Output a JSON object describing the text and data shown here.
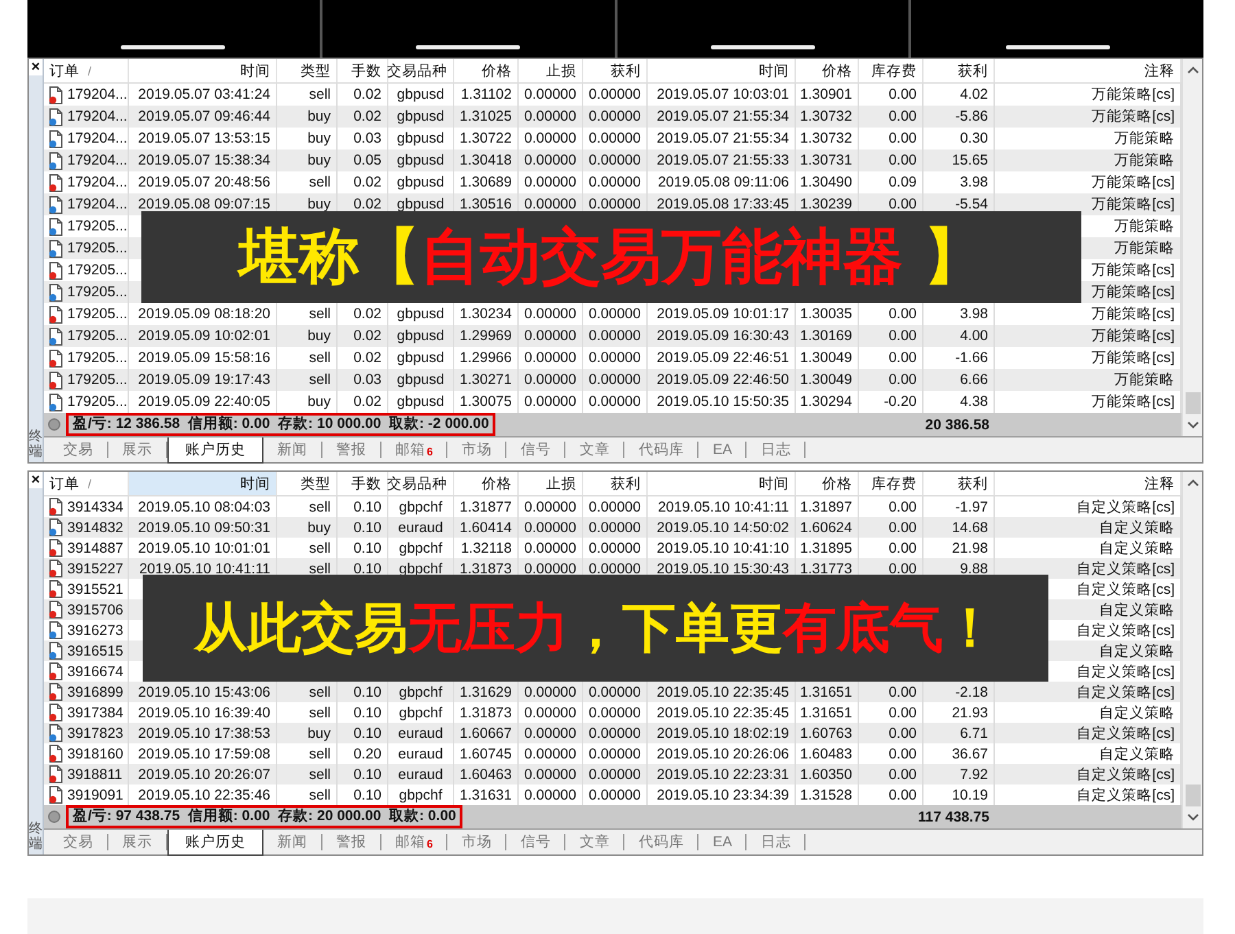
{
  "panels": [
    {
      "close": "×",
      "side_label": "终端",
      "sort_mark": "/",
      "columns": [
        {
          "label": "订单",
          "highlighted": false
        },
        {
          "label": "时间",
          "highlighted": false
        },
        {
          "label": "类型",
          "highlighted": false
        },
        {
          "label": "手数",
          "highlighted": false
        },
        {
          "label": "交易品种",
          "highlighted": false
        },
        {
          "label": "价格",
          "highlighted": false
        },
        {
          "label": "止损",
          "highlighted": false
        },
        {
          "label": "获利",
          "highlighted": false
        },
        {
          "label": "时间",
          "highlighted": false
        },
        {
          "label": "价格",
          "highlighted": false
        },
        {
          "label": "库存费",
          "highlighted": false
        },
        {
          "label": "获利",
          "highlighted": false
        },
        {
          "label": "注释",
          "highlighted": false
        }
      ],
      "rows": [
        {
          "kind": "sell",
          "order": "179204...",
          "cells": [
            "2019.05.07 03:41:24",
            "sell",
            "0.02",
            "gbpusd",
            "1.31102",
            "0.00000",
            "0.00000",
            "2019.05.07 10:03:01",
            "1.30901",
            "0.00",
            "4.02"
          ],
          "comment": "万能策略[cs]"
        },
        {
          "kind": "buy",
          "order": "179204...",
          "cells": [
            "2019.05.07 09:46:44",
            "buy",
            "0.02",
            "gbpusd",
            "1.31025",
            "0.00000",
            "0.00000",
            "2019.05.07 21:55:34",
            "1.30732",
            "0.00",
            "-5.86"
          ],
          "comment": "万能策略[cs]"
        },
        {
          "kind": "buy",
          "order": "179204...",
          "cells": [
            "2019.05.07 13:53:15",
            "buy",
            "0.03",
            "gbpusd",
            "1.30722",
            "0.00000",
            "0.00000",
            "2019.05.07 21:55:34",
            "1.30732",
            "0.00",
            "0.30"
          ],
          "comment": "万能策略"
        },
        {
          "kind": "buy",
          "order": "179204...",
          "cells": [
            "2019.05.07 15:38:34",
            "buy",
            "0.05",
            "gbpusd",
            "1.30418",
            "0.00000",
            "0.00000",
            "2019.05.07 21:55:33",
            "1.30731",
            "0.00",
            "15.65"
          ],
          "comment": "万能策略"
        },
        {
          "kind": "sell",
          "order": "179204...",
          "cells": [
            "2019.05.07 20:48:56",
            "sell",
            "0.02",
            "gbpusd",
            "1.30689",
            "0.00000",
            "0.00000",
            "2019.05.08 09:11:06",
            "1.30490",
            "0.09",
            "3.98"
          ],
          "comment": "万能策略[cs]"
        },
        {
          "kind": "buy",
          "order": "179204...",
          "cells": [
            "2019.05.08 09:07:15",
            "buy",
            "0.02",
            "gbpusd",
            "1.30516",
            "0.00000",
            "0.00000",
            "2019.05.08 17:33:45",
            "1.30239",
            "0.00",
            "-5.54"
          ],
          "comment": "万能策略[cs]"
        },
        {
          "kind": "buy",
          "order": "179205...",
          "comment": "万能策略"
        },
        {
          "kind": "buy",
          "order": "179205...",
          "comment": "万能策略"
        },
        {
          "kind": "sell",
          "order": "179205...",
          "comment": "万能策略[cs]"
        },
        {
          "kind": "buy",
          "order": "179205...",
          "comment": "万能策略[cs]"
        },
        {
          "kind": "sell",
          "order": "179205...",
          "cells": [
            "2019.05.09 08:18:20",
            "sell",
            "0.02",
            "gbpusd",
            "1.30234",
            "0.00000",
            "0.00000",
            "2019.05.09 10:01:17",
            "1.30035",
            "0.00",
            "3.98"
          ],
          "comment": "万能策略[cs]"
        },
        {
          "kind": "buy",
          "order": "179205...",
          "cells": [
            "2019.05.09 10:02:01",
            "buy",
            "0.02",
            "gbpusd",
            "1.29969",
            "0.00000",
            "0.00000",
            "2019.05.09 16:30:43",
            "1.30169",
            "0.00",
            "4.00"
          ],
          "comment": "万能策略[cs]"
        },
        {
          "kind": "sell",
          "order": "179205...",
          "cells": [
            "2019.05.09 15:58:16",
            "sell",
            "0.02",
            "gbpusd",
            "1.29966",
            "0.00000",
            "0.00000",
            "2019.05.09 22:46:51",
            "1.30049",
            "0.00",
            "-1.66"
          ],
          "comment": "万能策略[cs]"
        },
        {
          "kind": "sell",
          "order": "179205...",
          "cells": [
            "2019.05.09 19:17:43",
            "sell",
            "0.03",
            "gbpusd",
            "1.30271",
            "0.00000",
            "0.00000",
            "2019.05.09 22:46:50",
            "1.30049",
            "0.00",
            "6.66"
          ],
          "comment": "万能策略"
        },
        {
          "kind": "buy",
          "order": "179205...",
          "cells": [
            "2019.05.09 22:40:05",
            "buy",
            "0.02",
            "gbpusd",
            "1.30075",
            "0.00000",
            "0.00000",
            "2019.05.10 15:50:35",
            "1.30294",
            "-0.20",
            "4.38"
          ],
          "comment": "万能策略[cs]"
        }
      ],
      "summary": "盈/亏: 12 386.58  信用额: 0.00  存款: 10 000.00  取款: -2 000.00",
      "total": "20 386.58",
      "tabs": [
        {
          "label": "交易",
          "selected": false
        },
        {
          "label": "展示",
          "selected": false
        },
        {
          "label": "账户历史",
          "selected": true
        },
        {
          "label": "新闻",
          "selected": false
        },
        {
          "label": "警报",
          "selected": false
        },
        {
          "label": "邮箱",
          "selected": false,
          "badge": "6"
        },
        {
          "label": "市场",
          "selected": false
        },
        {
          "label": "信号",
          "selected": false
        },
        {
          "label": "文章",
          "selected": false
        },
        {
          "label": "代码库",
          "selected": false
        },
        {
          "label": "EA",
          "selected": false
        },
        {
          "label": "日志",
          "selected": false
        }
      ],
      "banner": [
        {
          "text": "堪称【",
          "color": "#ffe800"
        },
        {
          "text": "自动交易万能神器",
          "color": "#ff0a0a"
        },
        {
          "text": " 】",
          "color": "#ffe800"
        }
      ]
    },
    {
      "close": "×",
      "side_label": "终端",
      "sort_mark": "/",
      "columns": [
        {
          "label": "订单",
          "highlighted": false
        },
        {
          "label": "时间",
          "highlighted": true
        },
        {
          "label": "类型",
          "highlighted": false
        },
        {
          "label": "手数",
          "highlighted": false
        },
        {
          "label": "交易品种",
          "highlighted": false
        },
        {
          "label": "价格",
          "highlighted": false
        },
        {
          "label": "止损",
          "highlighted": false
        },
        {
          "label": "获利",
          "highlighted": false
        },
        {
          "label": "时间",
          "highlighted": false
        },
        {
          "label": "价格",
          "highlighted": false
        },
        {
          "label": "库存费",
          "highlighted": false
        },
        {
          "label": "获利",
          "highlighted": false
        },
        {
          "label": "注释",
          "highlighted": false
        }
      ],
      "rows": [
        {
          "kind": "sell",
          "order": "3914334",
          "cells": [
            "2019.05.10 08:04:03",
            "sell",
            "0.10",
            "gbpchf",
            "1.31877",
            "0.00000",
            "0.00000",
            "2019.05.10 10:41:11",
            "1.31897",
            "0.00",
            "-1.97"
          ],
          "comment": "自定义策略[cs]"
        },
        {
          "kind": "buy",
          "order": "3914832",
          "cells": [
            "2019.05.10 09:50:31",
            "buy",
            "0.10",
            "euraud",
            "1.60414",
            "0.00000",
            "0.00000",
            "2019.05.10 14:50:02",
            "1.60624",
            "0.00",
            "14.68"
          ],
          "comment": "自定义策略"
        },
        {
          "kind": "sell",
          "order": "3914887",
          "cells": [
            "2019.05.10 10:01:01",
            "sell",
            "0.10",
            "gbpchf",
            "1.32118",
            "0.00000",
            "0.00000",
            "2019.05.10 10:41:10",
            "1.31895",
            "0.00",
            "21.98"
          ],
          "comment": "自定义策略"
        },
        {
          "kind": "sell",
          "order": "3915227",
          "cells": [
            "2019.05.10 10:41:11",
            "sell",
            "0.10",
            "gbpchf",
            "1.31873",
            "0.00000",
            "0.00000",
            "2019.05.10 15:30:43",
            "1.31773",
            "0.00",
            "9.88"
          ],
          "comment": "自定义策略[cs]"
        },
        {
          "kind": "sell",
          "order": "3915521",
          "comment": "自定义策略[cs]"
        },
        {
          "kind": "sell",
          "order": "3915706",
          "comment": "自定义策略"
        },
        {
          "kind": "buy",
          "order": "3916273",
          "comment": "自定义策略[cs]"
        },
        {
          "kind": "buy",
          "order": "3916515",
          "comment": "自定义策略"
        },
        {
          "kind": "sell",
          "order": "3916674",
          "comment": "自定义策略[cs]"
        },
        {
          "kind": "sell",
          "order": "3916899",
          "cells": [
            "2019.05.10 15:43:06",
            "sell",
            "0.10",
            "gbpchf",
            "1.31629",
            "0.00000",
            "0.00000",
            "2019.05.10 22:35:45",
            "1.31651",
            "0.00",
            "-2.18"
          ],
          "comment": "自定义策略[cs]"
        },
        {
          "kind": "sell",
          "order": "3917384",
          "cells": [
            "2019.05.10 16:39:40",
            "sell",
            "0.10",
            "gbpchf",
            "1.31873",
            "0.00000",
            "0.00000",
            "2019.05.10 22:35:45",
            "1.31651",
            "0.00",
            "21.93"
          ],
          "comment": "自定义策略"
        },
        {
          "kind": "buy",
          "order": "3917823",
          "cells": [
            "2019.05.10 17:38:53",
            "buy",
            "0.10",
            "euraud",
            "1.60667",
            "0.00000",
            "0.00000",
            "2019.05.10 18:02:19",
            "1.60763",
            "0.00",
            "6.71"
          ],
          "comment": "自定义策略[cs]"
        },
        {
          "kind": "sell",
          "order": "3918160",
          "cells": [
            "2019.05.10 17:59:08",
            "sell",
            "0.20",
            "euraud",
            "1.60745",
            "0.00000",
            "0.00000",
            "2019.05.10 20:26:06",
            "1.60483",
            "0.00",
            "36.67"
          ],
          "comment": "自定义策略"
        },
        {
          "kind": "sell",
          "order": "3918811",
          "cells": [
            "2019.05.10 20:26:07",
            "sell",
            "0.10",
            "euraud",
            "1.60463",
            "0.00000",
            "0.00000",
            "2019.05.10 22:23:31",
            "1.60350",
            "0.00",
            "7.92"
          ],
          "comment": "自定义策略[cs]"
        },
        {
          "kind": "sell",
          "order": "3919091",
          "cells": [
            "2019.05.10 22:35:46",
            "sell",
            "0.10",
            "gbpchf",
            "1.31631",
            "0.00000",
            "0.00000",
            "2019.05.10 23:34:39",
            "1.31528",
            "0.00",
            "10.19"
          ],
          "comment": "自定义策略[cs]"
        }
      ],
      "summary": "盈/亏: 97 438.75  信用额: 0.00  存款: 20 000.00  取款: 0.00",
      "total": "117 438.75",
      "tabs": [
        {
          "label": "交易",
          "selected": false
        },
        {
          "label": "展示",
          "selected": false
        },
        {
          "label": "账户历史",
          "selected": true
        },
        {
          "label": "新闻",
          "selected": false
        },
        {
          "label": "警报",
          "selected": false
        },
        {
          "label": "邮箱",
          "selected": false,
          "badge": "6"
        },
        {
          "label": "市场",
          "selected": false
        },
        {
          "label": "信号",
          "selected": false
        },
        {
          "label": "文章",
          "selected": false
        },
        {
          "label": "代码库",
          "selected": false
        },
        {
          "label": "EA",
          "selected": false
        },
        {
          "label": "日志",
          "selected": false
        }
      ],
      "banner": [
        {
          "text": "从此交易",
          "color": "#ffe800"
        },
        {
          "text": "无压力",
          "color": "#ff0a0a"
        },
        {
          "text": "，下单更",
          "color": "#ffe800"
        },
        {
          "text": "有底气",
          "color": "#ff0a0a"
        },
        {
          "text": "！",
          "color": "#ffe800"
        }
      ]
    }
  ]
}
